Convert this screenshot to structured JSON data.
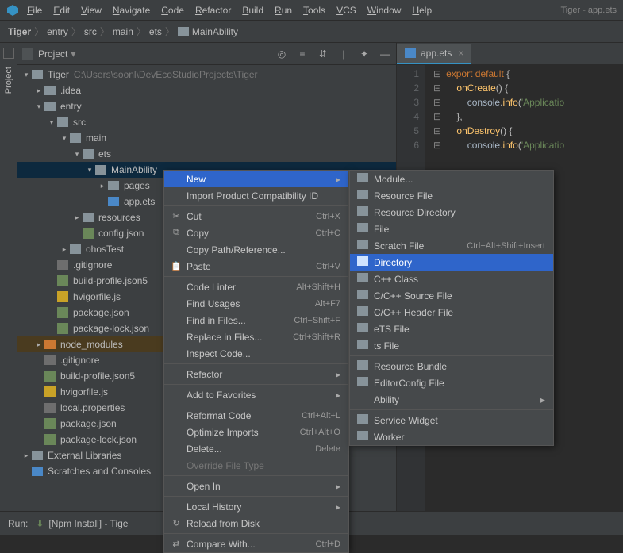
{
  "window": {
    "title_sub": "Tiger - app.ets"
  },
  "menubar": [
    "File",
    "Edit",
    "View",
    "Navigate",
    "Code",
    "Refactor",
    "Build",
    "Run",
    "Tools",
    "VCS",
    "Window",
    "Help"
  ],
  "breadcrumb": {
    "root": "Tiger",
    "parts": [
      "entry",
      "src",
      "main",
      "ets"
    ],
    "last": "MainAbility"
  },
  "gutter": {
    "tab": "Project"
  },
  "side": {
    "header": "Project",
    "root": {
      "label": "Tiger",
      "path": "C:\\Users\\soonl\\DevEcoStudioProjects\\Tiger"
    },
    "nodes": {
      "idea": ".idea",
      "entry": "entry",
      "src": "src",
      "main": "main",
      "ets": "ets",
      "mainability": "MainAbility",
      "pages": "pages",
      "appets": "app.ets",
      "resources": "resources",
      "configjson": "config.json",
      "ohostest": "ohosTest",
      "gitignore": ".gitignore",
      "buildprofile": "build-profile.json5",
      "hvigorfile": "hvigorfile.js",
      "packagejson": "package.json",
      "packagelock": "package-lock.json",
      "nodemodules": "node_modules",
      "gitignore2": ".gitignore",
      "buildprofile2": "build-profile.json5",
      "hvigorfile2": "hvigorfile.js",
      "localprops": "local.properties",
      "packagejson2": "package.json",
      "packagelock2": "package-lock.json",
      "extlibs": "External Libraries",
      "scratches": "Scratches and Consoles"
    }
  },
  "editor": {
    "tab": "app.ets",
    "lines": [
      {
        "n": "1",
        "t": "export default {"
      },
      {
        "n": "2",
        "t": "    onCreate() {"
      },
      {
        "n": "3",
        "t": "        console.info('Applicatio"
      },
      {
        "n": "4",
        "t": "    },"
      },
      {
        "n": "5",
        "t": "    onDestroy() {"
      },
      {
        "n": "6",
        "t": "        console.info('Applicatio"
      }
    ]
  },
  "ctx": {
    "items": [
      {
        "label": "New",
        "sub": true,
        "sel": true
      },
      {
        "label": "Import Product Compatibility ID"
      },
      {
        "sep": true
      },
      {
        "icon": "✂",
        "label": "Cut",
        "sc": "Ctrl+X"
      },
      {
        "icon": "⧉",
        "label": "Copy",
        "sc": "Ctrl+C"
      },
      {
        "label": "Copy Path/Reference..."
      },
      {
        "icon": "📋",
        "label": "Paste",
        "sc": "Ctrl+V"
      },
      {
        "sep": true
      },
      {
        "label": "Code Linter",
        "sc": "Alt+Shift+H"
      },
      {
        "label": "Find Usages",
        "sc": "Alt+F7"
      },
      {
        "label": "Find in Files...",
        "sc": "Ctrl+Shift+F"
      },
      {
        "label": "Replace in Files...",
        "sc": "Ctrl+Shift+R"
      },
      {
        "label": "Inspect Code..."
      },
      {
        "sep": true
      },
      {
        "label": "Refactor",
        "sub": true
      },
      {
        "sep": true
      },
      {
        "label": "Add to Favorites",
        "sub": true
      },
      {
        "sep": true
      },
      {
        "label": "Reformat Code",
        "sc": "Ctrl+Alt+L"
      },
      {
        "label": "Optimize Imports",
        "sc": "Ctrl+Alt+O"
      },
      {
        "label": "Delete...",
        "sc": "Delete"
      },
      {
        "label": "Override File Type",
        "dis": true
      },
      {
        "sep": true
      },
      {
        "label": "Open In",
        "sub": true
      },
      {
        "sep": true
      },
      {
        "label": "Local History",
        "sub": true
      },
      {
        "icon": "↻",
        "label": "Reload from Disk"
      },
      {
        "sep": true
      },
      {
        "icon": "⇄",
        "label": "Compare With...",
        "sc": "Ctrl+D"
      }
    ]
  },
  "subctx": {
    "items": [
      {
        "label": "Module...",
        "ic": "fic"
      },
      {
        "label": "Resource File",
        "ic": "fic"
      },
      {
        "label": "Resource Directory",
        "ic": "fic"
      },
      {
        "label": "File",
        "ic": "fic"
      },
      {
        "label": "Scratch File",
        "ic": "fic",
        "sc": "Ctrl+Alt+Shift+Insert"
      },
      {
        "label": "Directory",
        "ic": "fic",
        "sel": true
      },
      {
        "label": "C++ Class",
        "ic": "fic"
      },
      {
        "label": "C/C++ Source File",
        "ic": "fic"
      },
      {
        "label": "C/C++ Header File",
        "ic": "fic"
      },
      {
        "label": "eTS File",
        "ic": "fic"
      },
      {
        "label": "ts File",
        "ic": "fic"
      },
      {
        "sep": true
      },
      {
        "label": "Resource Bundle",
        "ic": "fic"
      },
      {
        "label": "EditorConfig File",
        "ic": "fic"
      },
      {
        "label": "Ability",
        "sub": true
      },
      {
        "sep": true
      },
      {
        "label": "Service Widget",
        "ic": "fic"
      },
      {
        "label": "Worker",
        "ic": "fic"
      }
    ]
  },
  "run": {
    "label": "Run:",
    "task": "[Npm Install] - Tige"
  }
}
